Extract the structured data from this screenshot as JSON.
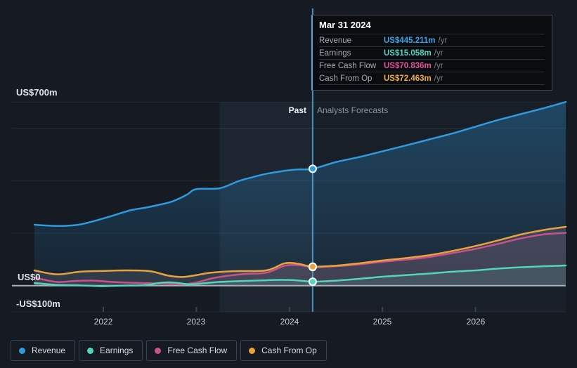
{
  "axis": {
    "y_labels": [
      "US$700m",
      "US$0",
      "-US$100m"
    ],
    "x_labels": [
      "2022",
      "2023",
      "2024",
      "2025",
      "2026"
    ]
  },
  "annotations": {
    "past": "Past",
    "forecast": "Analysts Forecasts"
  },
  "tooltip": {
    "date": "Mar 31 2024",
    "rows": [
      {
        "label": "Revenue",
        "value": "US$445.211m",
        "suffix": "/yr",
        "color": "#3AA5EA"
      },
      {
        "label": "Earnings",
        "value": "US$15.058m",
        "suffix": "/yr",
        "color": "#4ED5C0"
      },
      {
        "label": "Free Cash Flow",
        "value": "US$70.836m",
        "suffix": "/yr",
        "color": "#E3519C"
      },
      {
        "label": "Cash From Op",
        "value": "US$72.463m",
        "suffix": "/yr",
        "color": "#EFAD41"
      }
    ]
  },
  "legend": {
    "items": [
      {
        "label": "Revenue",
        "color": "#2E9BDF"
      },
      {
        "label": "Earnings",
        "color": "#52D5BD"
      },
      {
        "label": "Free Cash Flow",
        "color": "#C9518C"
      },
      {
        "label": "Cash From Op",
        "color": "#E9A33B"
      }
    ]
  },
  "colors": {
    "background": "#151A23",
    "gridline": "rgba(255,255,255,0.07)",
    "zero_line": "#A9AFB6",
    "divider": "#5AA5D7",
    "highlight_band": "rgba(148,190,235,0.065)",
    "forecast_band": "rgba(148,190,235,0.03)",
    "tick": "#3B434D"
  },
  "chart_data": {
    "type": "line",
    "units": "US$ millions per year",
    "ylim": [
      -100,
      700
    ],
    "x_range": [
      2021.25,
      2026.97
    ],
    "x_ticks": [
      2022,
      2023,
      2024,
      2025,
      2026
    ],
    "y_gridlines": [
      700,
      600,
      400,
      200,
      -100
    ],
    "divider_x": 2024.25,
    "divider_date": "Mar 31 2024",
    "highlight_band": [
      2023.25,
      2024.25
    ],
    "legend_position": "bottom-left",
    "series": [
      {
        "name": "Revenue",
        "color": "#2E9BDF",
        "fill": "gradient-blue",
        "points": [
          [
            2021.26,
            232
          ],
          [
            2021.45,
            228
          ],
          [
            2021.6,
            228
          ],
          [
            2021.75,
            233
          ],
          [
            2021.9,
            246
          ],
          [
            2022.0,
            256
          ],
          [
            2022.15,
            272
          ],
          [
            2022.3,
            288
          ],
          [
            2022.45,
            297
          ],
          [
            2022.6,
            308
          ],
          [
            2022.75,
            322
          ],
          [
            2022.9,
            347
          ],
          [
            2023.0,
            368
          ],
          [
            2023.25,
            371
          ],
          [
            2023.45,
            398
          ],
          [
            2023.6,
            413
          ],
          [
            2023.75,
            426
          ],
          [
            2023.95,
            438
          ],
          [
            2024.1,
            443
          ],
          [
            2024.25,
            445.211
          ],
          [
            2024.5,
            471
          ],
          [
            2024.75,
            490
          ],
          [
            2025.0,
            512
          ],
          [
            2025.25,
            534
          ],
          [
            2025.5,
            557
          ],
          [
            2025.75,
            580
          ],
          [
            2026.0,
            606
          ],
          [
            2026.25,
            632
          ],
          [
            2026.5,
            655
          ],
          [
            2026.75,
            678
          ],
          [
            2026.97,
            700
          ]
        ]
      },
      {
        "name": "Earnings",
        "color": "#52D5BD",
        "fill": "rgba(100,225,200,0.12)",
        "points": [
          [
            2021.26,
            10
          ],
          [
            2021.5,
            3
          ],
          [
            2021.75,
            1
          ],
          [
            2022.0,
            -2
          ],
          [
            2022.2,
            0
          ],
          [
            2022.45,
            2
          ],
          [
            2022.62,
            11
          ],
          [
            2022.75,
            12
          ],
          [
            2022.92,
            5
          ],
          [
            2023.05,
            8
          ],
          [
            2023.2,
            13
          ],
          [
            2023.45,
            17
          ],
          [
            2023.7,
            20
          ],
          [
            2023.9,
            22
          ],
          [
            2024.05,
            21
          ],
          [
            2024.25,
            15.058
          ],
          [
            2024.5,
            19
          ],
          [
            2024.75,
            26
          ],
          [
            2025.0,
            34
          ],
          [
            2025.25,
            40
          ],
          [
            2025.5,
            46
          ],
          [
            2025.75,
            53
          ],
          [
            2026.0,
            58
          ],
          [
            2026.25,
            65
          ],
          [
            2026.5,
            70
          ],
          [
            2026.75,
            74
          ],
          [
            2026.97,
            77
          ]
        ]
      },
      {
        "name": "Free Cash Flow",
        "color": "#C9518C",
        "fill": "rgba(205,95,155,0.10)",
        "points": [
          [
            2021.26,
            31
          ],
          [
            2021.5,
            14
          ],
          [
            2021.7,
            18
          ],
          [
            2021.9,
            19
          ],
          [
            2022.1,
            14
          ],
          [
            2022.4,
            10
          ],
          [
            2022.65,
            8
          ],
          [
            2022.85,
            5
          ],
          [
            2023.0,
            12
          ],
          [
            2023.2,
            30
          ],
          [
            2023.5,
            44
          ],
          [
            2023.75,
            49
          ],
          [
            2023.95,
            76
          ],
          [
            2024.1,
            78
          ],
          [
            2024.25,
            70.836
          ],
          [
            2024.5,
            74
          ],
          [
            2024.75,
            81
          ],
          [
            2025.0,
            91
          ],
          [
            2025.25,
            99
          ],
          [
            2025.5,
            109
          ],
          [
            2025.75,
            124
          ],
          [
            2026.0,
            140
          ],
          [
            2026.25,
            160
          ],
          [
            2026.5,
            181
          ],
          [
            2026.75,
            196
          ],
          [
            2026.97,
            201
          ]
        ]
      },
      {
        "name": "Cash From Op",
        "color": "#E9A33B",
        "fill": "rgba(216,200,205,0.13)",
        "points": [
          [
            2021.26,
            58
          ],
          [
            2021.5,
            43
          ],
          [
            2021.75,
            53
          ],
          [
            2022.0,
            56
          ],
          [
            2022.25,
            58
          ],
          [
            2022.5,
            55
          ],
          [
            2022.7,
            38
          ],
          [
            2022.85,
            33
          ],
          [
            2023.0,
            40
          ],
          [
            2023.15,
            49
          ],
          [
            2023.4,
            55
          ],
          [
            2023.75,
            58
          ],
          [
            2023.95,
            85
          ],
          [
            2024.1,
            83
          ],
          [
            2024.25,
            72.463
          ],
          [
            2024.5,
            76
          ],
          [
            2024.75,
            85
          ],
          [
            2025.0,
            96
          ],
          [
            2025.25,
            105
          ],
          [
            2025.5,
            116
          ],
          [
            2025.75,
            132
          ],
          [
            2026.0,
            151
          ],
          [
            2026.25,
            173
          ],
          [
            2026.5,
            196
          ],
          [
            2026.75,
            213
          ],
          [
            2026.97,
            224
          ]
        ]
      }
    ]
  }
}
